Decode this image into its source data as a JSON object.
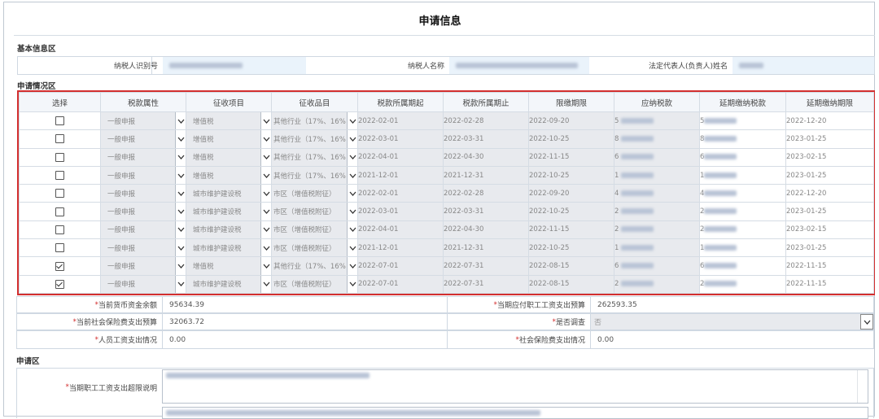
{
  "title": "申请信息",
  "basic": {
    "section": "基本信息区",
    "taxpayer_id_label": "纳税人识别号",
    "taxpayer_name_label": "纳税人名称",
    "legal_rep_label": "法定代表人(负责人)姓名"
  },
  "application_status": {
    "section": "申请情况区",
    "columns": [
      "选择",
      "税款属性",
      "征收项目",
      "征收品目",
      "税款所属期起",
      "税款所属期止",
      "限缴期限",
      "应纳税款",
      "延期缴纳税款",
      "延期缴纳期限"
    ],
    "rows": [
      {
        "checked": false,
        "attr": "一般申报",
        "item": "增值税",
        "sub": "其他行业（17%、16%",
        "start": "2022-02-01",
        "end": "2022-02-28",
        "limit": "2022-09-20",
        "due": "5",
        "defer": "5",
        "deadline": "2022-12-20"
      },
      {
        "checked": false,
        "attr": "一般申报",
        "item": "增值税",
        "sub": "其他行业（17%、16%",
        "start": "2022-03-01",
        "end": "2022-03-31",
        "limit": "2022-10-25",
        "due": "8",
        "defer": "8",
        "deadline": "2023-01-25"
      },
      {
        "checked": false,
        "attr": "一般申报",
        "item": "增值税",
        "sub": "其他行业（17%、16%",
        "start": "2022-04-01",
        "end": "2022-04-30",
        "limit": "2022-11-15",
        "due": "6",
        "defer": "6",
        "deadline": "2023-02-15"
      },
      {
        "checked": false,
        "attr": "一般申报",
        "item": "增值税",
        "sub": "其他行业（17%、16%",
        "start": "2021-12-01",
        "end": "2021-12-31",
        "limit": "2022-10-25",
        "due": "1",
        "defer": "1",
        "deadline": "2023-01-25"
      },
      {
        "checked": false,
        "attr": "一般申报",
        "item": "城市维护建设税",
        "sub": "市区（增值税附征）",
        "start": "2022-02-01",
        "end": "2022-02-28",
        "limit": "2022-09-20",
        "due": "4",
        "defer": "4",
        "deadline": "2022-12-20"
      },
      {
        "checked": false,
        "attr": "一般申报",
        "item": "城市维护建设税",
        "sub": "市区（增值税附征）",
        "start": "2022-03-01",
        "end": "2022-03-31",
        "limit": "2022-10-25",
        "due": "2",
        "defer": "2",
        "deadline": "2023-01-25"
      },
      {
        "checked": false,
        "attr": "一般申报",
        "item": "城市维护建设税",
        "sub": "市区（增值税附征）",
        "start": "2022-04-01",
        "end": "2022-04-30",
        "limit": "2022-11-15",
        "due": "2",
        "defer": "2",
        "deadline": "2023-02-15"
      },
      {
        "checked": false,
        "attr": "一般申报",
        "item": "城市维护建设税",
        "sub": "市区（增值税附征）",
        "start": "2021-12-01",
        "end": "2021-12-31",
        "limit": "2022-10-25",
        "due": "1",
        "defer": "1",
        "deadline": "2023-01-25"
      },
      {
        "checked": true,
        "attr": "一般申报",
        "item": "增值税",
        "sub": "其他行业（17%、16%",
        "start": "2022-07-01",
        "end": "2022-07-31",
        "limit": "2022-08-15",
        "due": "6",
        "defer": "6",
        "deadline": "2022-11-15"
      },
      {
        "checked": true,
        "attr": "一般申报",
        "item": "城市维护建设税",
        "sub": "市区（增值税附征）",
        "start": "2022-07-01",
        "end": "2022-07-31",
        "limit": "2022-08-15",
        "due": "2",
        "defer": "2",
        "deadline": "2022-11-15"
      }
    ]
  },
  "finance": {
    "cash_balance_label": "当前货币资金余额",
    "cash_balance_value": "95634.39",
    "wage_budget_label": "当期应付职工工资支出预算",
    "wage_budget_value": "262593.35",
    "social_budget_label": "当前社会保险费支出预算",
    "social_budget_value": "32063.72",
    "investigate_label": "是否调查",
    "investigate_value": "否",
    "wage_status_label": "人员工资支出情况",
    "wage_status_value": "0.00",
    "social_status_label": "社会保险费支出情况",
    "social_status_value": "0.00"
  },
  "apply": {
    "section": "申请区",
    "wage_explain_label": "当期职工工资支出超限说明"
  },
  "colors": {
    "highlight_border": "#d32f2f",
    "required": "#d32f2f"
  }
}
